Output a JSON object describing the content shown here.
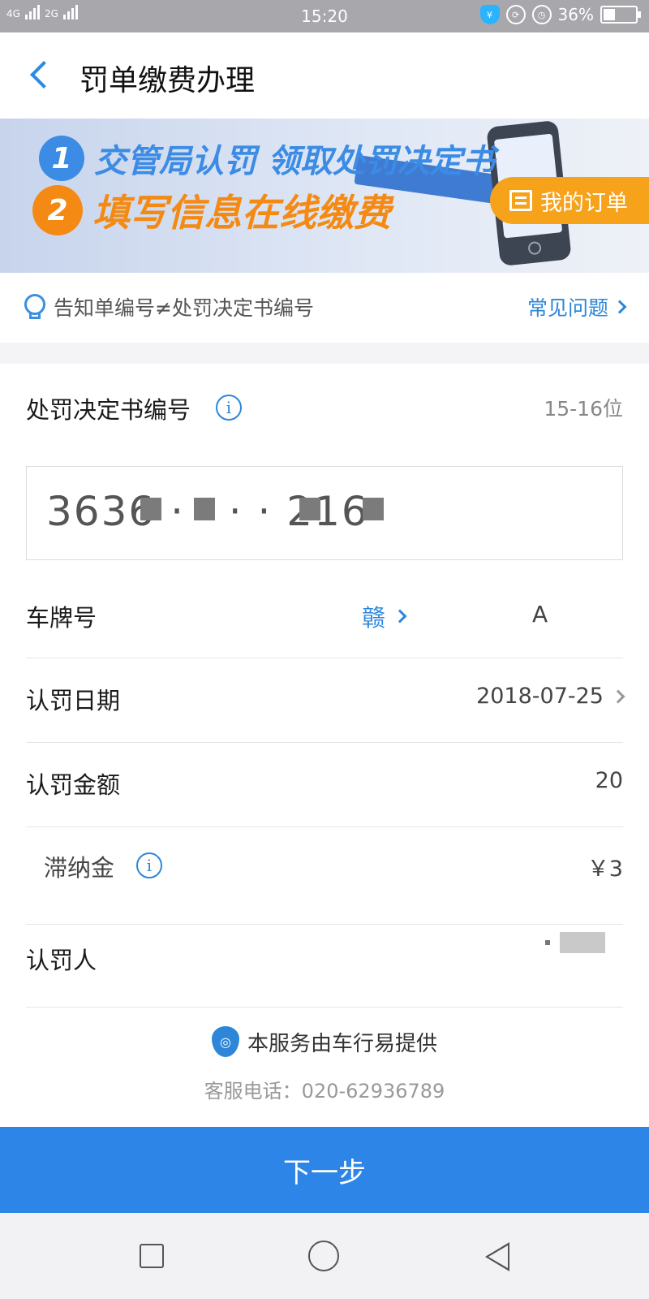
{
  "status_bar": {
    "network_1": "4G",
    "network_2": "2G",
    "time": "15:20",
    "battery_percent_label": "36%",
    "battery_level": 0.36,
    "icons": [
      "shield-yen-icon",
      "rotation-lock-icon",
      "alarm-icon",
      "battery-icon"
    ]
  },
  "header": {
    "title": "罚单缴费办理"
  },
  "banner": {
    "step1_num": "1",
    "step1_text": "交管局认罚 领取处罚决定书",
    "step2_num": "2",
    "step2_text": "填写信息在线缴费",
    "my_orders": "我的订单"
  },
  "tip": {
    "text": "告知单编号≠处罚决定书编号",
    "faq_link": "常见问题"
  },
  "form": {
    "decision_no_label": "处罚决定书编号",
    "decision_no_hint": "15-16位",
    "decision_no_value": "3636  ·   ·   ·   ·  216",
    "plate_label": "车牌号",
    "plate_prefix": "赣",
    "plate_value": "A",
    "date_label": "认罚日期",
    "date_value": "2018-07-25",
    "amount_label": "认罚金额",
    "amount_value": "20",
    "late_fee_label": "滞纳金",
    "late_fee_value": "￥3",
    "person_label": "认罚人"
  },
  "footer": {
    "provider": "本服务由车行易提供",
    "hotline": "客服电话：020-62936789",
    "next_button": "下一步"
  },
  "colors": {
    "accent": "#2d86e7",
    "orange": "#f7a21b"
  }
}
